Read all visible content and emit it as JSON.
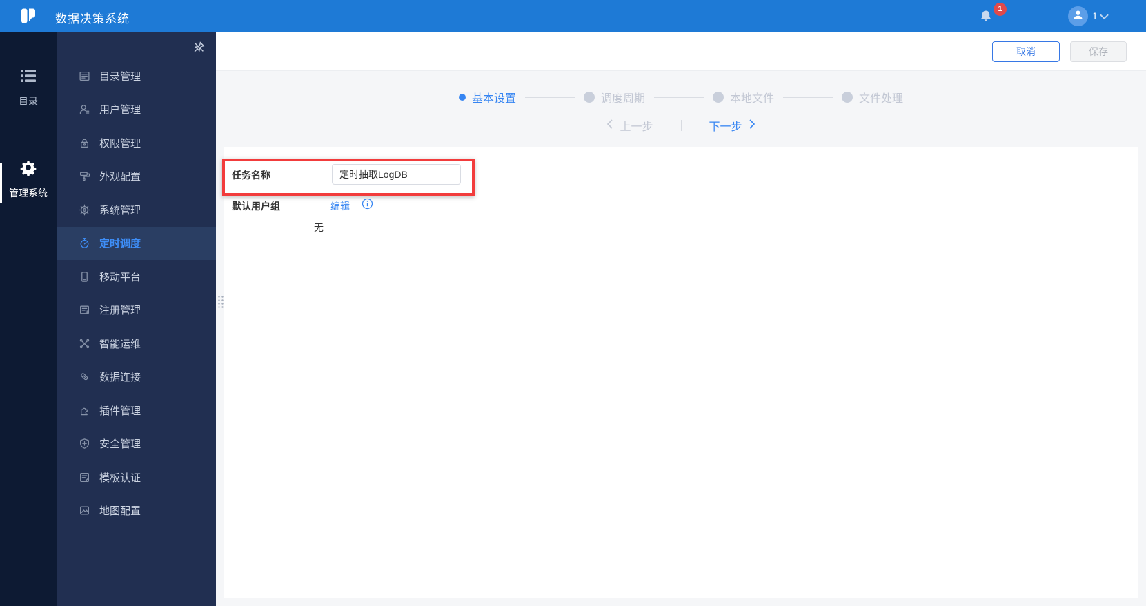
{
  "topbar": {
    "title": "数据决策系统",
    "notification_count": "1",
    "user_label": "1"
  },
  "rail": {
    "items": [
      {
        "label": "目录",
        "icon": "directory",
        "active": false
      },
      {
        "label": "管理系统",
        "icon": "gear-solid",
        "active": true
      }
    ]
  },
  "sidebar": {
    "items": [
      {
        "label": "目录管理",
        "icon": "catalog",
        "active": false
      },
      {
        "label": "用户管理",
        "icon": "user",
        "active": false
      },
      {
        "label": "权限管理",
        "icon": "lock",
        "active": false
      },
      {
        "label": "外观配置",
        "icon": "paint",
        "active": false
      },
      {
        "label": "系统管理",
        "icon": "gear",
        "active": false
      },
      {
        "label": "定时调度",
        "icon": "timer",
        "active": true
      },
      {
        "label": "移动平台",
        "icon": "mobile",
        "active": false
      },
      {
        "label": "注册管理",
        "icon": "register",
        "active": false
      },
      {
        "label": "智能运维",
        "icon": "ops",
        "active": false
      },
      {
        "label": "数据连接",
        "icon": "clip",
        "active": false
      },
      {
        "label": "插件管理",
        "icon": "plugin",
        "active": false
      },
      {
        "label": "安全管理",
        "icon": "shield",
        "active": false
      },
      {
        "label": "模板认证",
        "icon": "cert",
        "active": false
      },
      {
        "label": "地图配置",
        "icon": "map",
        "active": false
      }
    ]
  },
  "toolbar": {
    "cancel_label": "取消",
    "save_label": "保存"
  },
  "stepper": {
    "steps": [
      {
        "label": "基本设置",
        "state": "active"
      },
      {
        "label": "调度周期",
        "state": "pending"
      },
      {
        "label": "本地文件",
        "state": "pending"
      },
      {
        "label": "文件处理",
        "state": "pending"
      }
    ],
    "prev_label": "上一步",
    "next_label": "下一步"
  },
  "form": {
    "task_name": {
      "label": "任务名称",
      "value": "定时抽取LogDB"
    },
    "default_group": {
      "label": "默认用户组",
      "edit_label": "编辑",
      "value": "无"
    }
  },
  "colors": {
    "topbar_blue": "#1E7AD6",
    "accent_blue": "#3685F2",
    "sidebar_navy": "#212F51",
    "rail_navy": "#0D1A33",
    "annotation_red": "#F23C3C",
    "badge_red": "#E14A4A"
  }
}
